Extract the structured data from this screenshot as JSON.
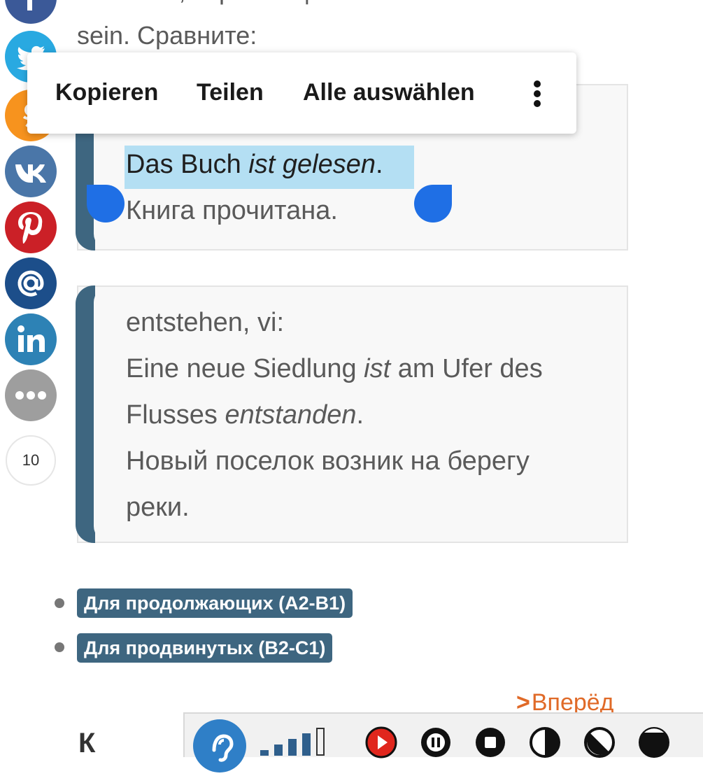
{
  "article": {
    "line_top": "глаголов, спрягающихся с",
    "line_2": "sein. Сравните:"
  },
  "context_menu": {
    "copy": "Kopieren",
    "share": "Teilen",
    "select_all": "Alle auswählen"
  },
  "example1": {
    "de_plain": "Das Buch ",
    "de_italic": "ist gelesen",
    "de_end": ".",
    "ru": "Книга прочитана."
  },
  "example2": {
    "verb": "entstehen, vi:",
    "de1_plain": "Eine neue Siedlung ",
    "de1_italic": "ist",
    "de1_end": " am Ufer des",
    "de2_plain": "Flusses ",
    "de2_italic": "entstanden",
    "de2_end": ".",
    "ru1": "Новый поселок возник на берегу",
    "ru2": "реки."
  },
  "links": [
    "Для продолжающих (A2-B1)",
    "Для продвинутых (B2-C1)"
  ],
  "next_label": "Вперёд",
  "share_count": "10",
  "bottom_letter": "К",
  "colors": {
    "accent": "#3e6680",
    "selection": "#b4dff3",
    "handle": "#1f6fe5",
    "next": "#e06a28"
  },
  "share_icons": [
    "facebook-icon",
    "twitter-icon",
    "odnoklassniki-icon",
    "vk-icon",
    "pinterest-icon",
    "mail-icon",
    "linkedin-icon",
    "more-icon"
  ],
  "toolbar_icons": [
    "hearing-icon",
    "volume-bars-icon",
    "play-icon",
    "pause-icon",
    "stop-icon",
    "contrast-half-icon",
    "contrast-diagonal-icon",
    "contrast-full-icon"
  ]
}
